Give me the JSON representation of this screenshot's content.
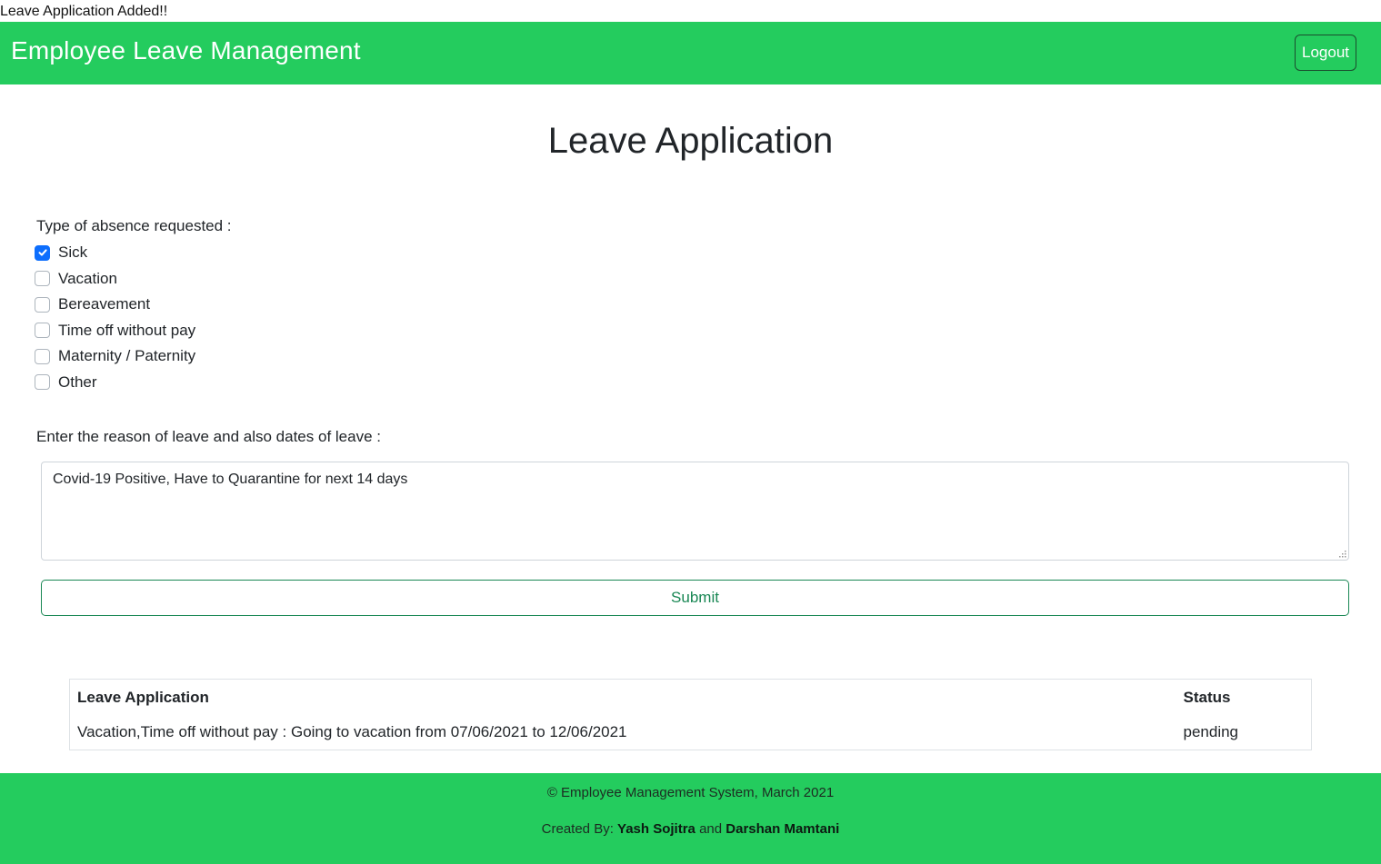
{
  "flash_message": "Leave Application Added!!",
  "navbar": {
    "brand": "Employee Leave Management",
    "logout_label": "Logout"
  },
  "page": {
    "title": "Leave Application"
  },
  "absence": {
    "label": "Type of absence requested :",
    "options": [
      {
        "label": "Sick",
        "checked": true
      },
      {
        "label": "Vacation",
        "checked": false
      },
      {
        "label": "Bereavement",
        "checked": false
      },
      {
        "label": "Time off without pay",
        "checked": false
      },
      {
        "label": "Maternity / Paternity",
        "checked": false
      },
      {
        "label": "Other",
        "checked": false
      }
    ]
  },
  "reason": {
    "label": "Enter the reason of leave and also dates of leave :",
    "value": "Covid-19 Positive, Have to Quarantine for next 14 days"
  },
  "submit_label": "Submit",
  "table": {
    "headers": [
      "Leave Application",
      "Status"
    ],
    "rows": [
      [
        "Vacation,Time off without pay : Going to vacation from 07/06/2021 to 12/06/2021",
        "pending"
      ]
    ]
  },
  "footer": {
    "copyright": "© Employee Management System, March 2021",
    "created_by_prefix": "Created By: ",
    "author1": "Yash Sojitra",
    "and_text": " and ",
    "author2": "Darshan Mamtani"
  },
  "colors": {
    "brand_green": "#24cc5e",
    "submit_green": "#198754",
    "checkbox_blue": "#0d6efd"
  }
}
